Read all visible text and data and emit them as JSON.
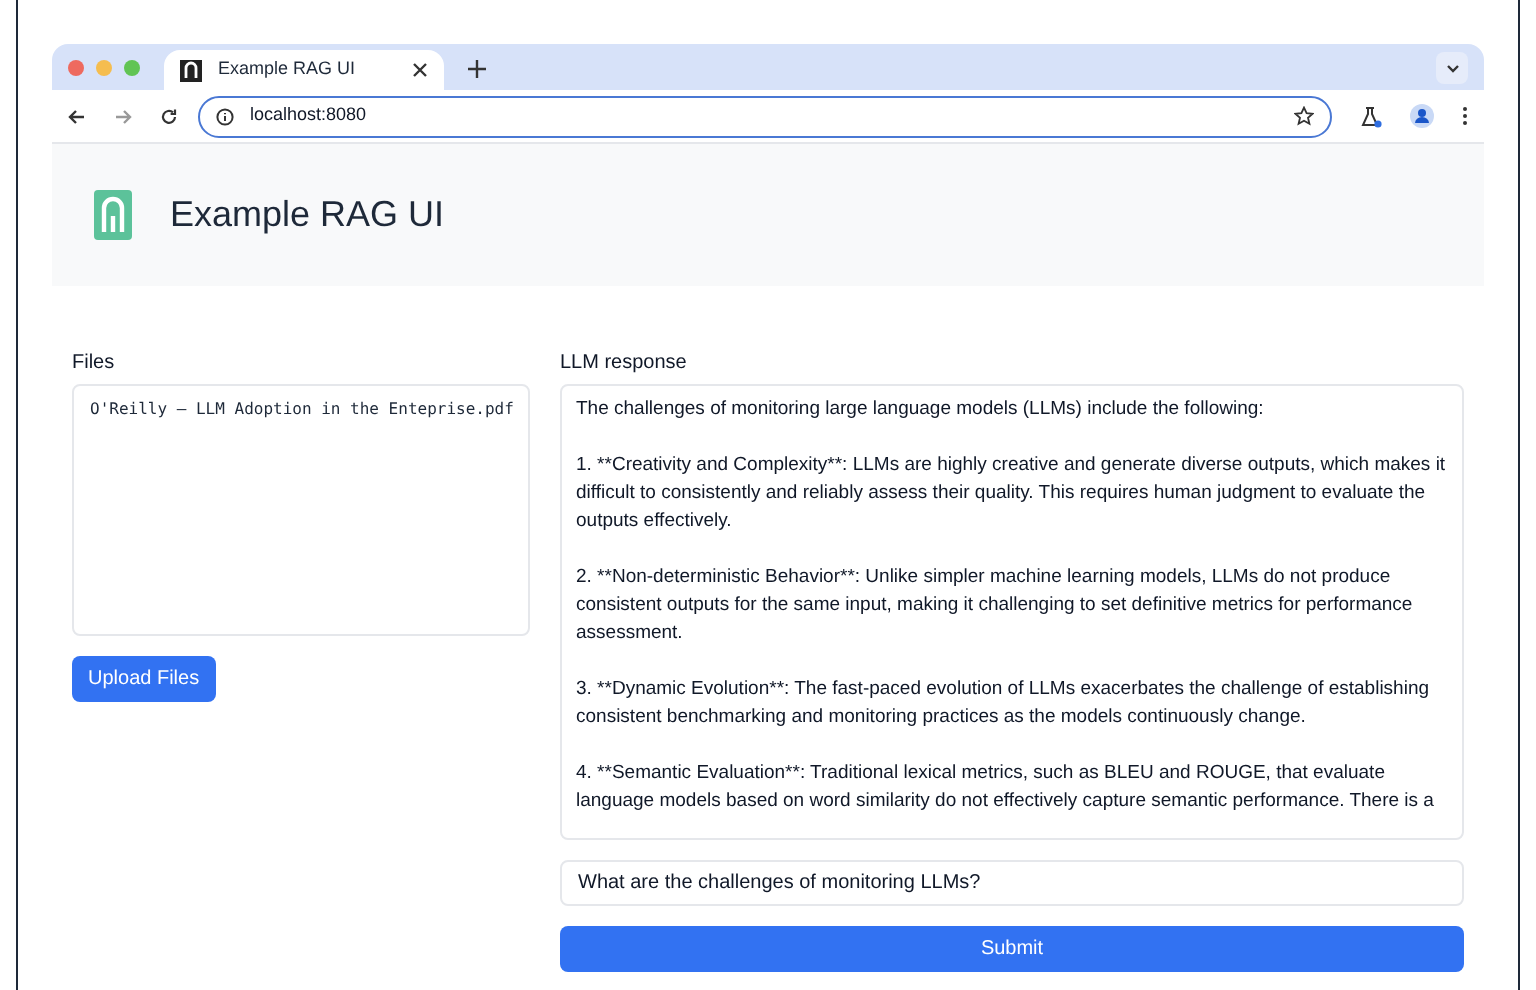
{
  "browser": {
    "tab": {
      "title": "Example RAG UI",
      "selected": true
    },
    "address": "localhost:8080"
  },
  "header": {
    "title": "Example RAG UI"
  },
  "files": {
    "label": "Files",
    "items": [
      "O'Reilly – LLM Adoption in the Enteprise.pdf"
    ],
    "upload_button": "Upload Files"
  },
  "response": {
    "label": "LLM response",
    "paragraphs": [
      "The challenges of monitoring large language models (LLMs) include the following:",
      "1. **Creativity and Complexity**: LLMs are highly creative and generate diverse outputs, which makes it difficult to consistently and reliably assess their quality. This requires human judgment to evaluate the outputs effectively.",
      "2. **Non-deterministic Behavior**: Unlike simpler machine learning models, LLMs do not produce consistent outputs for the same input, making it challenging to set definitive metrics for performance assessment.",
      "3. **Dynamic Evolution**: The fast-paced evolution of LLMs exacerbates the challenge of establishing consistent benchmarking and monitoring practices as the models continuously change.",
      "4. **Semantic Evaluation**: Traditional lexical metrics, such as BLEU and ROUGE, that evaluate language models based on word similarity do not effectively capture semantic performance. There is a"
    ]
  },
  "question": {
    "value": "What are the challenges of monitoring LLMs?"
  },
  "submit_button": "Submit"
}
